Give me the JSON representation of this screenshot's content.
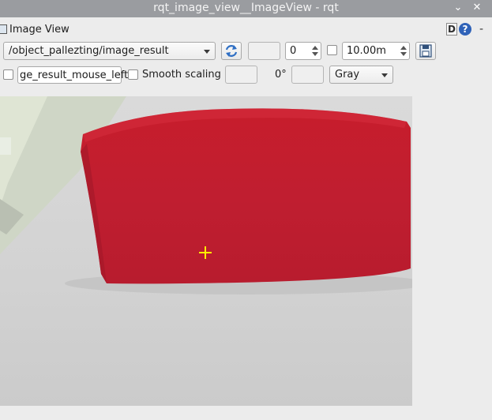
{
  "window": {
    "title": "rqt_image_view__ImageView - rqt",
    "min_glyph": "⌄",
    "close_glyph": "✕"
  },
  "dock": {
    "title": "Image View",
    "d_button": "D",
    "help_button": "?",
    "dash": "-"
  },
  "toolbar": {
    "topic_value": "/object_pallezting/image_result",
    "zoom_value": "0",
    "timeout_value": "10.00m",
    "mouse_topic_value": "ge_result_mouse_left",
    "smooth_scaling_label": "Smooth scaling",
    "rotation_label": "0°",
    "color_scheme_value": "Gray"
  },
  "colors": {
    "accent_yellow": "#ffee00",
    "object_red": "#c01e30",
    "background": "#ececec"
  }
}
